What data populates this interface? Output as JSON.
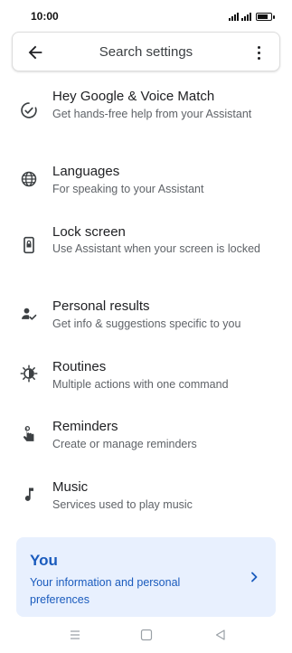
{
  "status_bar": {
    "time": "10:00",
    "battery_level": 0.85
  },
  "search": {
    "placeholder": "Search settings"
  },
  "items": [
    {
      "title": "Hey Google & Voice Match",
      "subtitle": "Get hands-free help from your Assistant",
      "icon": "voice-match-icon"
    },
    {
      "title": "Languages",
      "subtitle": "For speaking to your Assistant",
      "icon": "globe-icon"
    },
    {
      "title": "Lock screen",
      "subtitle": "Use Assistant when your screen is locked",
      "icon": "lock-screen-icon"
    },
    {
      "title": "Personal results",
      "subtitle": "Get info & suggestions specific to you",
      "icon": "person-check-icon"
    },
    {
      "title": "Routines",
      "subtitle": "Multiple actions with one command",
      "icon": "routines-icon"
    },
    {
      "title": "Reminders",
      "subtitle": "Create or manage reminders",
      "icon": "reminder-icon"
    },
    {
      "title": "Music",
      "subtitle": "Services used to play music",
      "icon": "music-note-icon"
    }
  ],
  "you_card": {
    "title": "You",
    "subtitle": "Your information and personal preferences"
  },
  "colors": {
    "accent": "#1a5bbd",
    "card_bg": "#e8f0fe",
    "icon": "#3c4043"
  }
}
